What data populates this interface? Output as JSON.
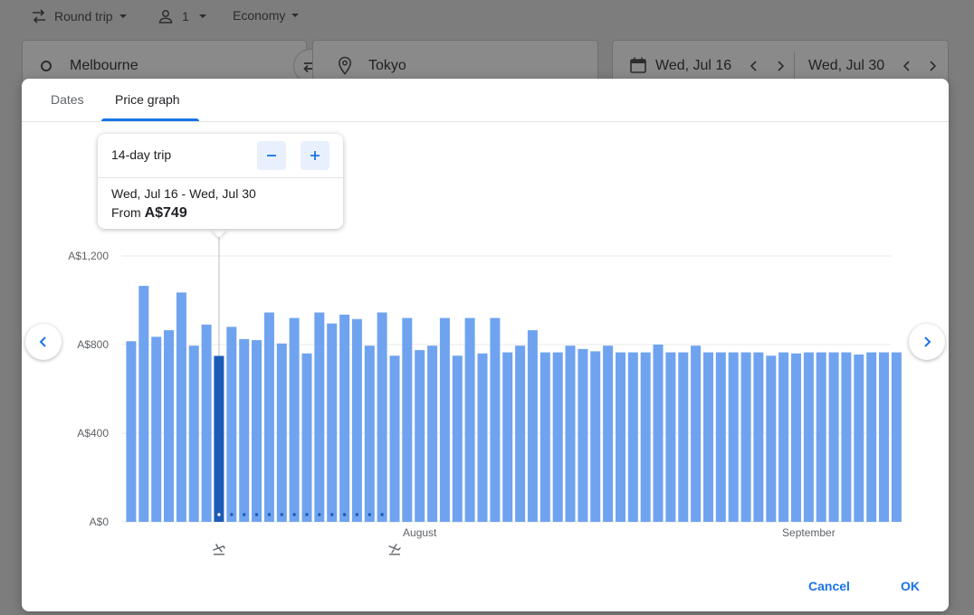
{
  "search": {
    "trip_type": "Round trip",
    "passengers": "1",
    "cabin_class": "Economy",
    "origin": "Melbourne",
    "destination": "Tokyo",
    "depart_date": "Wed, Jul 16",
    "return_date": "Wed, Jul 30"
  },
  "dialog": {
    "tabs": [
      {
        "label": "Dates",
        "active": false
      },
      {
        "label": "Price graph",
        "active": true
      }
    ],
    "trip_card": {
      "length_label": "14-day trip",
      "date_range": "Wed, Jul 16 - Wed, Jul 30",
      "price_prefix": "From",
      "price": "A$749"
    },
    "buttons": {
      "cancel": "Cancel",
      "ok": "OK"
    }
  },
  "colors": {
    "bar": "#6fa3f0",
    "bar_selected": "#1a5bb8",
    "accent": "#1a73e8"
  },
  "icons": {
    "departure": "flight-takeoff-icon",
    "return": "flight-land-icon",
    "prev": "chevron-left-icon",
    "next": "chevron-right-icon"
  },
  "chart_data": {
    "type": "bar",
    "ylim": [
      0,
      1200
    ],
    "yticks": [
      {
        "value": 0,
        "label": "A$0"
      },
      {
        "value": 400,
        "label": "A$400"
      },
      {
        "value": 800,
        "label": "A$800"
      },
      {
        "value": 1200,
        "label": "A$1,200"
      }
    ],
    "month_labels": [
      {
        "index": 23,
        "label": "August"
      },
      {
        "index": 54,
        "label": "September"
      }
    ],
    "selected_index": 7,
    "return_index": 21,
    "values": [
      815,
      1065,
      835,
      865,
      1035,
      795,
      890,
      749,
      880,
      825,
      820,
      945,
      805,
      920,
      760,
      945,
      895,
      935,
      915,
      795,
      945,
      750,
      920,
      775,
      795,
      920,
      750,
      920,
      760,
      920,
      765,
      795,
      865,
      765,
      765,
      795,
      780,
      770,
      795,
      765,
      765,
      765,
      800,
      765,
      765,
      795,
      765,
      765,
      765,
      765,
      765,
      750,
      765,
      760,
      765,
      765,
      765,
      765,
      755,
      765,
      765,
      765
    ]
  }
}
